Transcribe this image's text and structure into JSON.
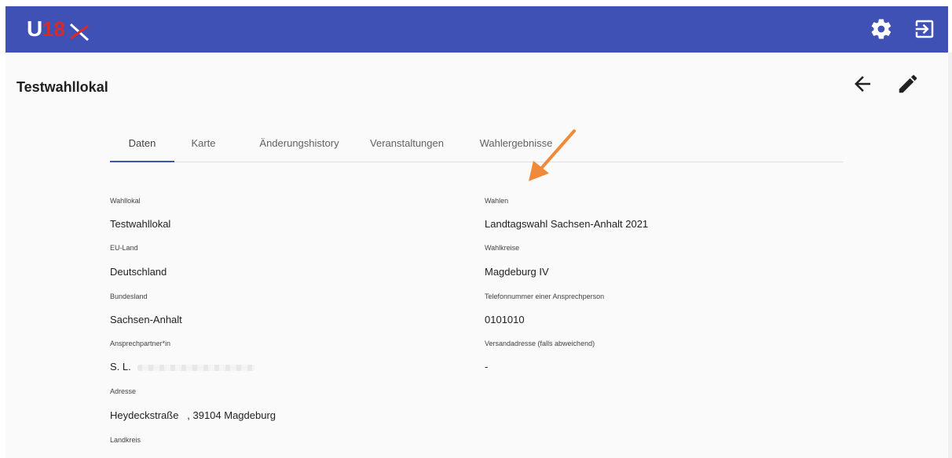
{
  "header": {
    "logo_text": "U18",
    "settings_icon": "gear-icon",
    "logout_icon": "logout-icon",
    "brand_color": "#3f51b5"
  },
  "page": {
    "title": "Testwahllokal",
    "back_icon": "arrow-left-icon",
    "edit_icon": "pencil-icon"
  },
  "tabs": [
    {
      "label": "Daten",
      "active": true
    },
    {
      "label": "Karte",
      "active": false
    },
    {
      "label": "Änderungshistory",
      "active": false
    },
    {
      "label": "Veranstaltungen",
      "active": false
    },
    {
      "label": "Wahlergebnisse",
      "active": false
    }
  ],
  "annotation": {
    "color": "#f08a3a",
    "icon": "arrow-pointer-icon"
  },
  "details": {
    "left": [
      {
        "label": "Wahllokal",
        "value": "Testwahllokal"
      },
      {
        "label": "EU-Land",
        "value": "Deutschland"
      },
      {
        "label": "Bundesland",
        "value": "Sachsen-Anhalt"
      },
      {
        "label": "Ansprechpartner*in",
        "value": "S. L."
      },
      {
        "label": "Adresse",
        "value": "Heydeckstraße   , 39104 Magdeburg"
      },
      {
        "label": "Landkreis",
        "value": ""
      }
    ],
    "right": [
      {
        "label": "Wahlen",
        "value": "Landtagswahl Sachsen-Anhalt 2021"
      },
      {
        "label": "Wahlkreise",
        "value": "Magdeburg IV"
      },
      {
        "label": "Telefonnummer einer Ansprechperson",
        "value": "0101010"
      },
      {
        "label": "Versandadresse (falls abweichend)",
        "value": "-"
      }
    ]
  }
}
